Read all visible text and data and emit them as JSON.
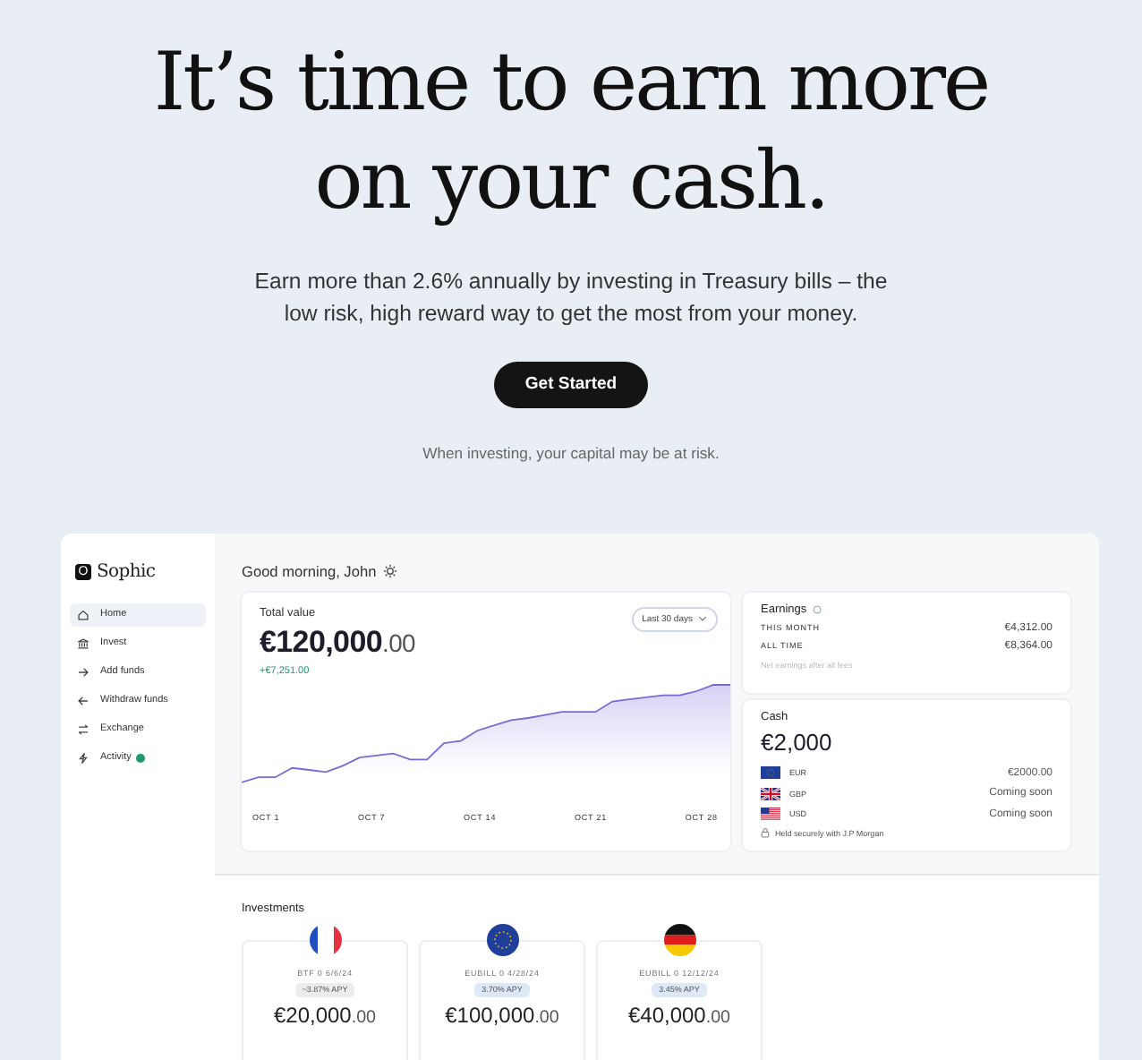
{
  "hero": {
    "title_lines": [
      "It’s time to earn more",
      "on your cash."
    ],
    "subtitle": "Earn more than 2.6% annually by investing in Treasury bills – the low risk, high reward way to get the most from your money.",
    "cta": "Get Started",
    "risk_note": "When investing, your capital may be at risk."
  },
  "app": {
    "logo_mark": "O",
    "logo": "Sophic",
    "nav": [
      {
        "label": "Home",
        "kind": "home",
        "selected": true,
        "badge": false
      },
      {
        "label": "Invest",
        "kind": "bank",
        "selected": false,
        "badge": false
      },
      {
        "label": "Add funds",
        "kind": "deposit",
        "selected": false,
        "badge": false
      },
      {
        "label": "Withdraw funds",
        "kind": "withdraw",
        "selected": false,
        "badge": false
      },
      {
        "label": "Exchange",
        "kind": "exchange",
        "selected": false,
        "badge": false
      },
      {
        "label": "Activity",
        "kind": "activity",
        "selected": false,
        "badge": true
      }
    ],
    "greeting": "Good morning, John",
    "total": {
      "label": "Total value",
      "amount": "€120,000",
      "cents": ".00",
      "change": "+€7,251.00",
      "range": "Last 30 days",
      "x_labels": [
        "OCT 1",
        "OCT 7",
        "OCT 14",
        "OCT 21",
        "OCT 28"
      ]
    },
    "earnings": {
      "title": "Earnings",
      "rows": [
        {
          "label": "THIS MONTH",
          "value": "€4,312.00"
        },
        {
          "label": "ALL TIME",
          "value": "€8,364.00"
        }
      ],
      "note": "Net earnings after all fees"
    },
    "cash": {
      "title": "Cash",
      "amount": "€2,000",
      "currencies": [
        {
          "code": "EUR",
          "value": "€2000.00",
          "kind": "eu"
        },
        {
          "code": "GBP",
          "value": "Coming soon",
          "kind": "uk"
        },
        {
          "code": "USD",
          "value": "Coming soon",
          "kind": "us"
        }
      ],
      "note": "Held securely with J.P Morgan"
    },
    "investments": {
      "title": "Investments",
      "items": [
        {
          "kind": "fr",
          "name": "BTF 0 6/6/24",
          "apy": "~3.87% APY",
          "estimated": true,
          "amount": "€20,000",
          "cents": ".00"
        },
        {
          "kind": "eu",
          "name": "EUBILL 0 4/28/24",
          "apy": "3.70% APY",
          "estimated": false,
          "amount": "€100,000",
          "cents": ".00"
        },
        {
          "kind": "de",
          "name": "EUBILL 0 12/12/24",
          "apy": "3.45% APY",
          "estimated": false,
          "amount": "€40,000",
          "cents": ".00"
        }
      ]
    }
  }
}
